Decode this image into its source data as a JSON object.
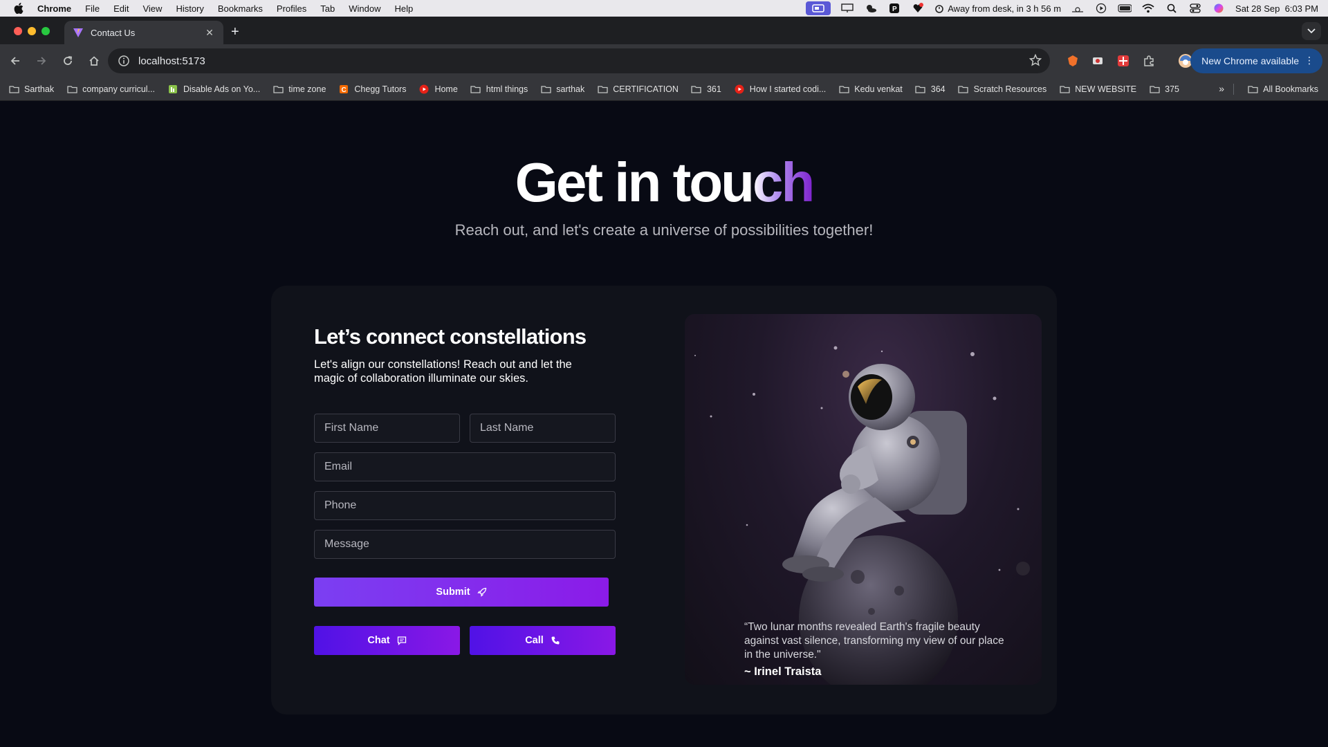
{
  "menubar": {
    "app": "Chrome",
    "items": [
      "File",
      "Edit",
      "View",
      "History",
      "Bookmarks",
      "Profiles",
      "Tab",
      "Window",
      "Help"
    ],
    "status_text": "Away from desk, in 3 h 56 m",
    "datetime": "Sat 28 Sep  6:03 PM"
  },
  "browser": {
    "tab_title": "Contact Us",
    "url": "localhost:5173",
    "update_label": "New Chrome available",
    "bookmarks": [
      {
        "label": "Sarthak",
        "icon": "folder-icon"
      },
      {
        "label": "company curricul...",
        "icon": "folder-icon"
      },
      {
        "label": "Disable Ads on Yo...",
        "icon": "extension-icon"
      },
      {
        "label": "time zone",
        "icon": "folder-icon"
      },
      {
        "label": "Chegg Tutors",
        "icon": "chegg-icon"
      },
      {
        "label": "Home",
        "icon": "youtube-icon"
      },
      {
        "label": "html things",
        "icon": "folder-icon"
      },
      {
        "label": "sarthak",
        "icon": "folder-icon"
      },
      {
        "label": "CERTIFICATION",
        "icon": "folder-icon"
      },
      {
        "label": "361",
        "icon": "folder-icon"
      },
      {
        "label": "How I started codi...",
        "icon": "youtube-icon"
      },
      {
        "label": "Kedu venkat",
        "icon": "folder-icon"
      },
      {
        "label": "364",
        "icon": "folder-icon"
      },
      {
        "label": "Scratch Resources",
        "icon": "folder-icon"
      },
      {
        "label": "NEW WEBSITE",
        "icon": "folder-icon"
      },
      {
        "label": "375",
        "icon": "folder-icon"
      }
    ],
    "all_bookmarks_label": "All Bookmarks"
  },
  "hero": {
    "title_plain": "Get in tou",
    "title_accent": "ch",
    "subtitle": "Reach out, and let's create a universe of possibilities together!"
  },
  "form": {
    "title": "Let’s connect constellations",
    "description": "Let's align our constellations! Reach out and let the magic of collaboration illuminate our skies.",
    "first_name_placeholder": "First Name",
    "last_name_placeholder": "Last Name",
    "email_placeholder": "Email",
    "phone_placeholder": "Phone",
    "message_placeholder": "Message",
    "submit_label": "Submit",
    "chat_label": "Chat",
    "call_label": "Call"
  },
  "testimonial": {
    "quote": "“Two lunar months revealed Earth's fragile beauty against vast silence, transforming my view of our place in the universe.\"",
    "author": "~ Irinel Traista"
  },
  "colors": {
    "page_bg": "#080a14",
    "card_bg": "#10121a",
    "accent_start": "#7b3ff2",
    "accent_end": "#8b1be8"
  }
}
